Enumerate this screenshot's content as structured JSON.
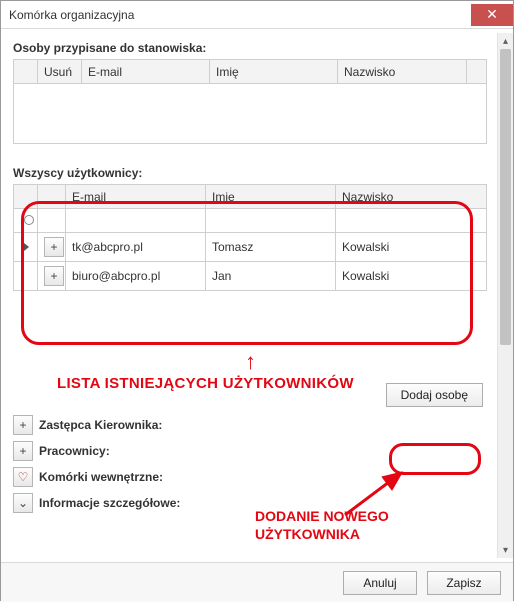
{
  "window": {
    "title": "Komórka organizacyjna"
  },
  "assigned": {
    "label": "Osoby przypisane do stanowiska:",
    "columns": {
      "delete": "Usuń",
      "email": "E-mail",
      "firstname": "Imię",
      "lastname": "Nazwisko"
    }
  },
  "allusers": {
    "label": "Wszyscy użytkownicy:",
    "columns": {
      "email": "E-mail",
      "firstname": "Imię",
      "lastname": "Nazwisko"
    },
    "rows": [
      {
        "email": "tk@abcpro.pl",
        "firstname": "Tomasz",
        "lastname": "Kowalski"
      },
      {
        "email": "biuro@abcpro.pl",
        "firstname": "Jan",
        "lastname": "Kowalski"
      }
    ]
  },
  "annotations": {
    "list_label": "LISTA ISTNIEJĄCYCH UŻYTKOWNIKÓW",
    "add_label_line1": "DODANIE NOWEGO",
    "add_label_line2": "UŻYTKOWNIKA"
  },
  "buttons": {
    "add_person": "Dodaj osobę",
    "cancel": "Anuluj",
    "save": "Zapisz"
  },
  "expanders": {
    "deputy": "Zastępca Kierownika:",
    "employees": "Pracownicy:",
    "internal_cells": "Komórki wewnętrzne:",
    "details": "Informacje szczegółowe:"
  },
  "icons": {
    "plus": "+",
    "chevron_down": "⌄",
    "close": "✕",
    "up": "▴",
    "down": "▾",
    "heart": "♡"
  }
}
